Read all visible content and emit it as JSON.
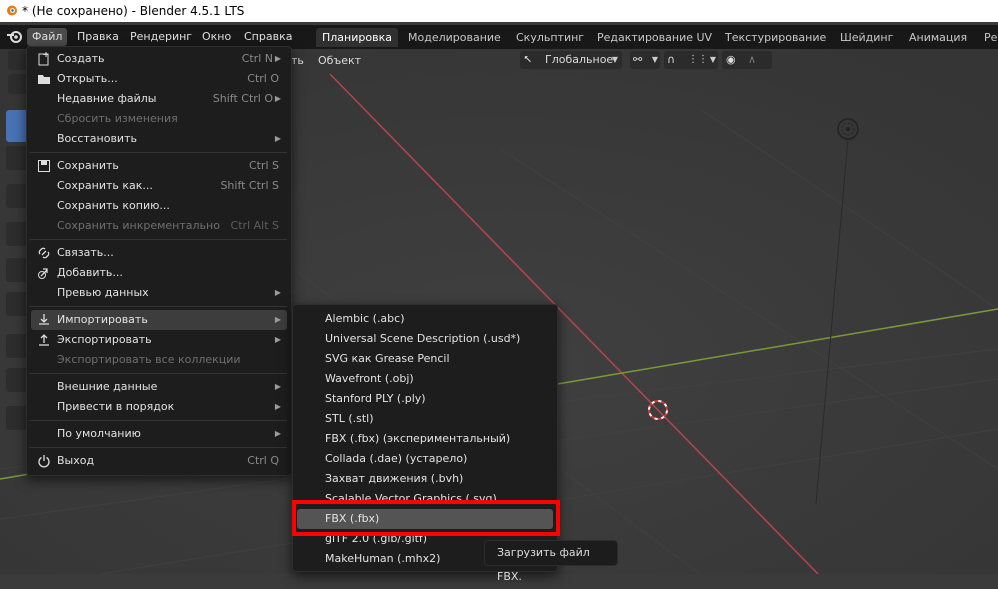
{
  "window": {
    "title": "* (Не сохранено) - Blender 4.5.1 LTS"
  },
  "menubar": {
    "items": [
      "Файл",
      "Правка",
      "Рендеринг",
      "Окно",
      "Справка"
    ],
    "active": "Файл"
  },
  "workspaces": {
    "tabs": [
      "Планировка",
      "Моделирование",
      "Скульптинг",
      "Редактирование UV",
      "Текстурирование",
      "Шейдинг",
      "Анимация",
      "Ре"
    ],
    "active": "Планировка"
  },
  "viewport_header": {
    "menu_tail": "ть",
    "object_menu": "Объект",
    "orientation": "Глобальное"
  },
  "file_menu": {
    "items": [
      {
        "label": "Создать",
        "shortcut": "Ctrl N",
        "icon": "new-file-icon",
        "submenu": true
      },
      {
        "label": "Открыть...",
        "shortcut": "Ctrl O",
        "icon": "folder-icon"
      },
      {
        "label": "Недавние файлы",
        "shortcut": "Shift Ctrl O",
        "submenu": true
      },
      {
        "label": "Сбросить изменения",
        "disabled": true
      },
      {
        "label": "Восстановить",
        "submenu": true
      },
      {
        "label": "Сохранить",
        "shortcut": "Ctrl S",
        "icon": "save-icon"
      },
      {
        "label": "Сохранить как...",
        "shortcut": "Shift Ctrl S"
      },
      {
        "label": "Сохранить копию..."
      },
      {
        "label": "Сохранить инкрементально",
        "shortcut": "Ctrl Alt S",
        "disabled": true
      },
      {
        "label": "Связать...",
        "icon": "link-icon"
      },
      {
        "label": "Добавить...",
        "icon": "append-icon"
      },
      {
        "label": "Превью данных",
        "submenu": true
      },
      {
        "label": "Импортировать",
        "icon": "import-icon",
        "submenu": true,
        "highlighted": true
      },
      {
        "label": "Экспортировать",
        "icon": "export-icon",
        "submenu": true
      },
      {
        "label": "Экспортировать все коллекции",
        "disabled": true
      },
      {
        "label": "Внешние данные",
        "submenu": true
      },
      {
        "label": "Привести в порядок",
        "submenu": true
      },
      {
        "label": "По умолчанию",
        "submenu": true
      },
      {
        "label": "Выход",
        "shortcut": "Ctrl Q",
        "icon": "power-icon"
      }
    ]
  },
  "import_submenu": {
    "items": [
      "Alembic (.abc)",
      "Universal Scene Description (.usd*)",
      "SVG как Grease Pencil",
      "Wavefront (.obj)",
      "Stanford PLY (.ply)",
      "STL (.stl)",
      "FBX (.fbx) (экспериментальный)",
      "Collada (.dae) (устарело)",
      "Захват движения (.bvh)",
      "Scalable Vector Graphics (.svg)",
      "FBX (.fbx)",
      "glTF 2.0 (.glb/.gltf)",
      "MakeHuman (.mhx2)"
    ],
    "highlighted": "FBX (.fbx)"
  },
  "tooltip": {
    "text": "Загрузить файл FBX."
  },
  "colors": {
    "accent_blue": "#4772b3",
    "annotation_red": "#ff0000",
    "axis_x": "#b3454f",
    "axis_y": "#7a9a3a"
  }
}
